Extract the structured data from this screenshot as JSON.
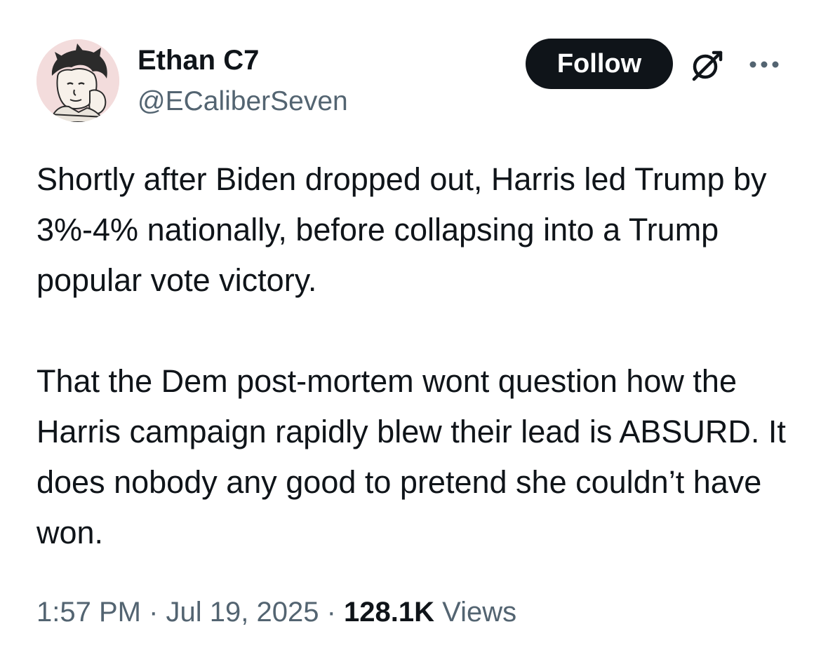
{
  "author": {
    "display_name": "Ethan C7",
    "handle": "@ECaliberSeven",
    "avatar_icon": "cartoon-avatar"
  },
  "actions": {
    "follow_label": "Follow",
    "grok_icon": "grok-icon",
    "more_icon": "more-icon"
  },
  "tweet": {
    "paragraphs": [
      "Shortly after Biden dropped out, Harris led Trump by 3%-4% nationally, before collapsing into a Trump popular vote victory.",
      "That the Dem post-mortem wont question how the Harris campaign rapidly blew their lead is ABSURD. It does nobody any good to pretend she couldn’t have won."
    ]
  },
  "meta": {
    "time": "1:57 PM",
    "sep1": " · ",
    "date": "Jul 19, 2025",
    "sep2": " · ",
    "views_count": "128.1K",
    "views_label": " Views"
  },
  "colors": {
    "text_primary": "#0f1419",
    "text_secondary": "#536471",
    "button_bg": "#0f1419",
    "button_text": "#ffffff",
    "avatar_bg": "#f3dcdc"
  }
}
